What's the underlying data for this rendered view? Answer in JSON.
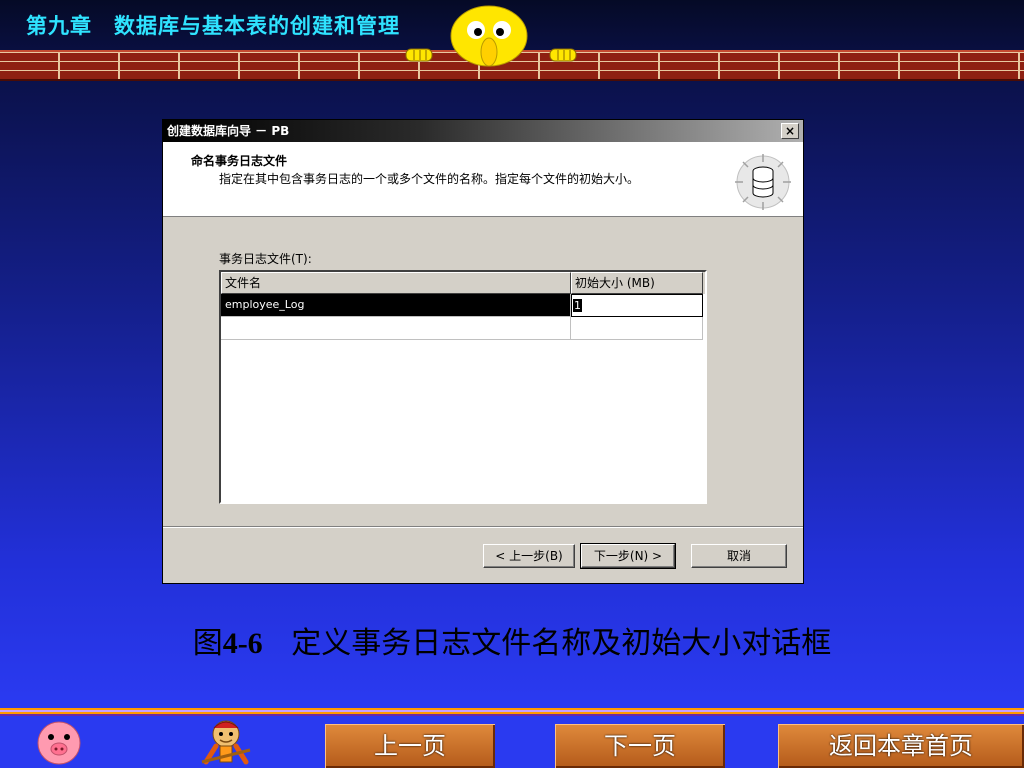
{
  "slide": {
    "title": "第九章　数据库与基本表的创建和管理"
  },
  "dialog": {
    "title": "创建数据库向导 － PB",
    "close_label": "×",
    "header_title": "命名事务日志文件",
    "header_desc": "指定在其中包含事务日志的一个或多个文件的名称。指定每个文件的初始大小。",
    "field_label": "事务日志文件(T):",
    "columns": [
      "文件名",
      "初始大小 (MB)"
    ],
    "rows": [
      {
        "name": "employee_Log",
        "size": "1"
      }
    ],
    "buttons": {
      "back": "< 上一步(B)",
      "next": "下一步(N) >",
      "cancel": "取消"
    }
  },
  "caption": {
    "prefix": "图",
    "number": "4-6",
    "text": "定义事务日志文件名称及初始大小对话框"
  },
  "nav": {
    "prev": "上一页",
    "next": "下一页",
    "back_to_chapter": "返回本章首页"
  }
}
